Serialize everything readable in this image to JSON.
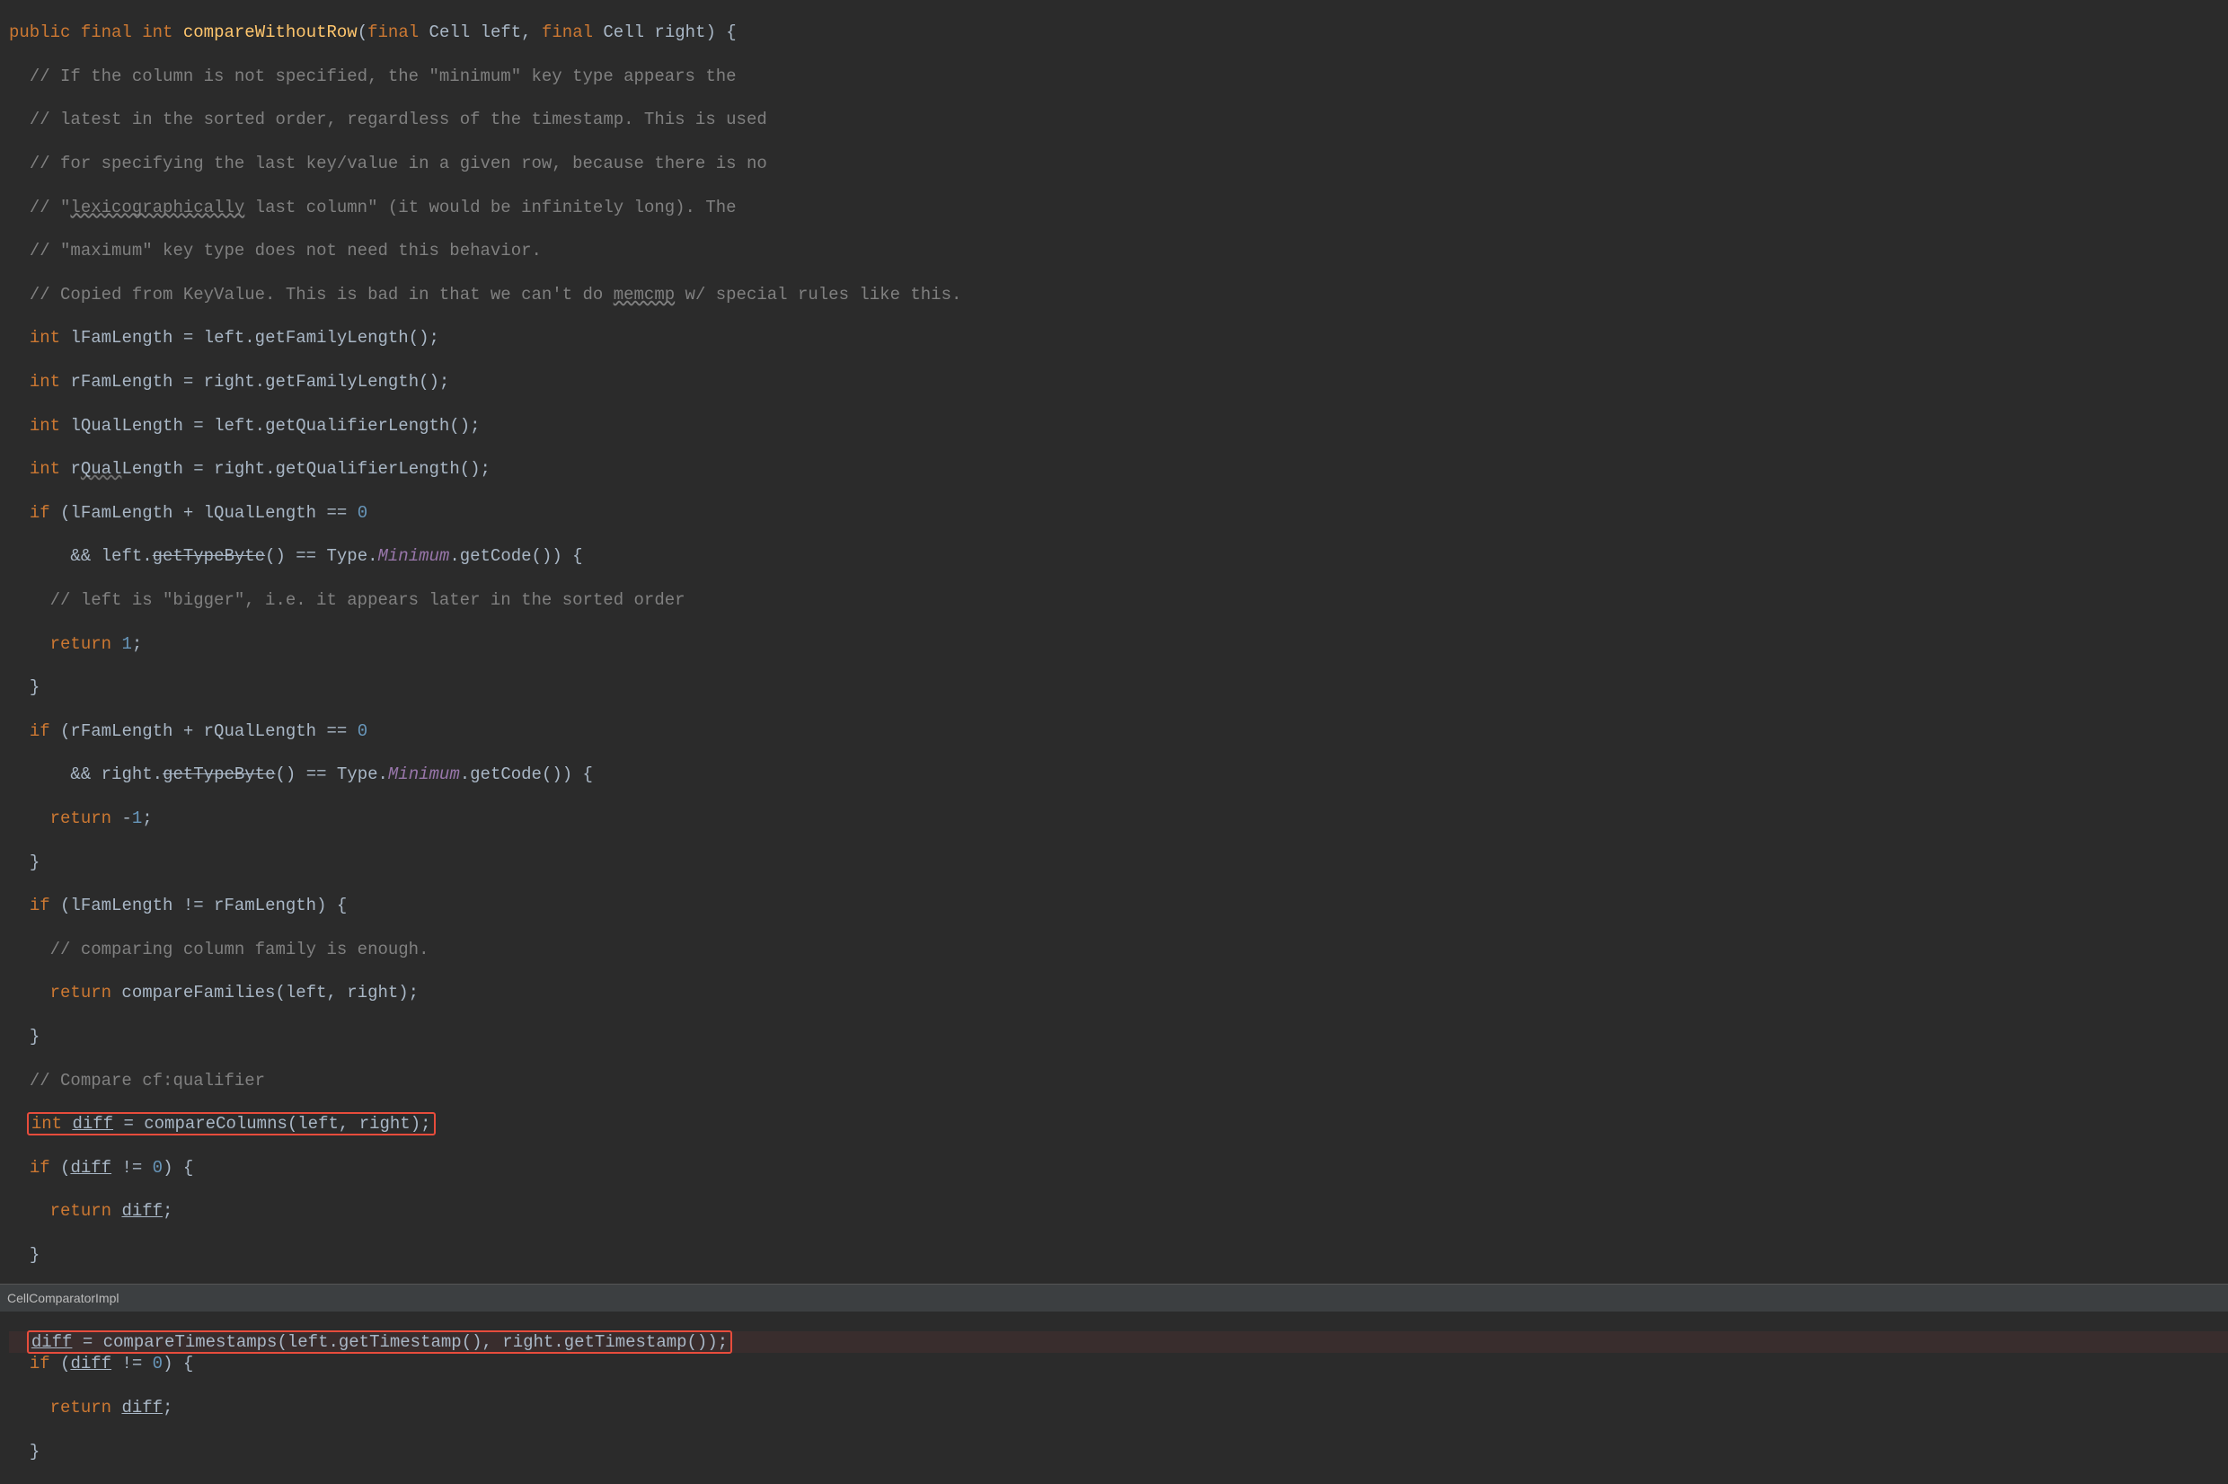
{
  "code": {
    "l1_kw1": "public",
    "l1_kw2": "final",
    "l1_kw3": "int",
    "l1_method": "compareWithoutRow",
    "l1_paren_open": "(",
    "l1_pkw1": "final",
    "l1_ptype1": "Cell",
    "l1_pname1": "left",
    "l1_comma": ", ",
    "l1_pkw2": "final",
    "l1_ptype2": "Cell",
    "l1_pname2": "right",
    "l1_paren_close": ") {",
    "c1": "// If the column is not specified, the \"minimum\" key type appears the",
    "c2": "// latest in the sorted order, regardless of the timestamp. This is used",
    "c3": "// for specifying the last key/value in a given row, because there is no",
    "c4": "// \"",
    "c4w": "lexicographically",
    "c4b": " last column\" (it would be infinitely long). The",
    "c5": "// \"maximum\" key type does not need this behavior.",
    "c6a": "// Copied from KeyValue. This is bad in that we can't do ",
    "c6w": "memcmp",
    "c6b": " w/ special rules like this.",
    "l7_kw": "int",
    "l7_var": "lFamLength",
    "l7_eq": " = left.getFamilyLength();",
    "l8_kw": "int",
    "l8_var": "rFamLength",
    "l8_eq": " = right.getFamilyLength();",
    "l9_kw": "int",
    "l9_var": "lQualLength",
    "l9_eq": " = left.getQualifierLength();",
    "l10_kw": "int",
    "l10_var_a": "r",
    "l10_var_w": "Qual",
    "l10_var_b": "Length",
    "l10_eq": " = right.getQualifierLength();",
    "l11_kw": "if",
    "l11_cond_a": " (lFamLength + lQualLength == ",
    "l11_zero": "0",
    "l12_and": "&& ",
    "l12_left": "left.",
    "l12_strike": "getTypeByte",
    "l12_paren": "() == Type.",
    "l12_min": "Minimum",
    "l12_code": ".getCode()) {",
    "c13": "// left is \"bigger\", i.e. it appears later in the sorted order",
    "l14_kw": "return",
    "l14_val": "1",
    "l14_semi": ";",
    "l15_brace": "}",
    "l16_kw": "if",
    "l16_cond_a": " (rFamLength + rQualLength == ",
    "l16_zero": "0",
    "l17_and": "&& ",
    "l17_right": "right.",
    "l17_strike": "getTypeByte",
    "l17_paren": "() == Type.",
    "l17_min": "Minimum",
    "l17_code": ".getCode()) {",
    "l18_kw": "return",
    "l18_val": " -",
    "l18_one": "1",
    "l18_semi": ";",
    "l19_brace": "}",
    "l20_kw": "if",
    "l20_cond": " (lFamLength != rFamLength) {",
    "c21": "// comparing column family is enough.",
    "l22_kw": "return",
    "l22_call": " compareFamilies(left, right);",
    "l23_brace": "}",
    "c24": "// Compare cf:qualifier",
    "l25_kw": "int",
    "l25_sp": " ",
    "l25_diff": "diff",
    "l25_eq": " = compareColumns(left, right);",
    "l26_kw": "if",
    "l26_a": " (",
    "l26_diff": "diff",
    "l26_b": " != ",
    "l26_zero": "0",
    "l26_c": ") {",
    "l27_kw": "return",
    "l27_sp": " ",
    "l27_diff": "diff",
    "l27_semi": ";",
    "l28_brace": "}",
    "l29_diff": "diff",
    "l29_eq": " = compareTimestamps(left.getTimestamp(), right.getTimestamp());",
    "l30_kw": "if",
    "l30_a": " (",
    "l30_diff": "diff",
    "l30_b": " != ",
    "l30_zero": "0",
    "l30_c": ") {",
    "l31_kw": "return",
    "l31_sp": " ",
    "l31_diff": "diff",
    "l31_semi": ";",
    "l32_brace": "}"
  },
  "status": {
    "filename": "CellComparatorImpl"
  }
}
